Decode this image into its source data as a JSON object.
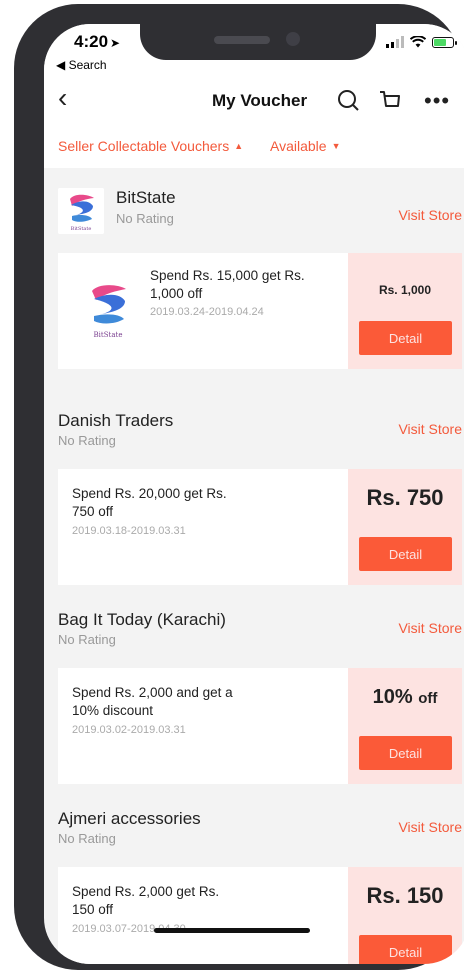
{
  "status_bar": {
    "time": "4:20",
    "back_label": "◀ Search"
  },
  "nav": {
    "title": "My Voucher"
  },
  "filters": {
    "type": "Seller Collectable Vouchers",
    "status": "Available"
  },
  "colors": {
    "accent": "#f35a3c",
    "button": "#fb5a38",
    "voucher_tint": "#fde3e1"
  },
  "stores": [
    {
      "name": "BitState",
      "rating": "No Rating",
      "visit": "Visit Store",
      "voucher": {
        "desc_line1": "Spend Rs. 15,000 get Rs.",
        "desc_line2": "1,000 off",
        "dates": "2019.03.24-2019.04.24",
        "amount": "Rs. 1,000",
        "detail": "Detail"
      },
      "logo_text": "BitState"
    },
    {
      "name": "Danish Traders",
      "rating": "No Rating",
      "visit": "Visit Store",
      "voucher": {
        "desc_line1": "Spend Rs. 20,000 get Rs.",
        "desc_line2": "750 off",
        "dates": "2019.03.18-2019.03.31",
        "amount": "Rs. 750",
        "detail": "Detail"
      }
    },
    {
      "name": "Bag It Today (Karachi)",
      "rating": "No Rating",
      "visit": "Visit Store",
      "voucher": {
        "desc_line1": "Spend Rs. 2,000 and get a",
        "desc_line2": "10% discount",
        "dates": "2019.03.02-2019.03.31",
        "amount_main": "10%",
        "amount_suffix": "off",
        "detail": "Detail"
      }
    },
    {
      "name": "Ajmeri accessories",
      "rating": "No Rating",
      "visit": "Visit Store",
      "voucher": {
        "desc_line1": "Spend Rs. 2,000 get Rs.",
        "desc_line2": "150 off",
        "dates": "2019.03.07-2019.04.30",
        "amount": "Rs. 150",
        "detail": "Detail"
      }
    }
  ]
}
